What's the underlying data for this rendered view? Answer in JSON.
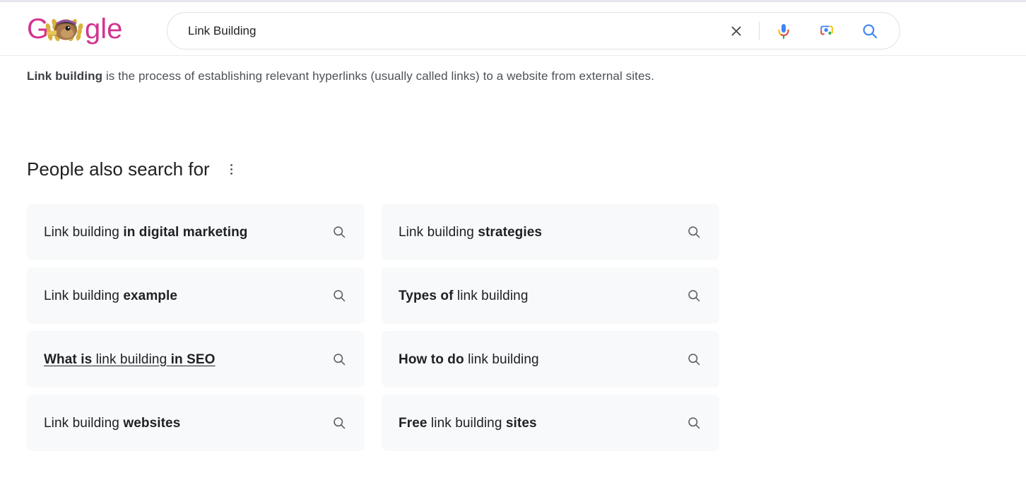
{
  "browser": {
    "top_bar_color": "#e8e7f0"
  },
  "header": {
    "logo": {
      "name": "google-doodle-logo",
      "alt": "Google Doodle",
      "letter_color": "#d2358f",
      "has_doodle": true,
      "doodle_subject": "duck-with-wheat-wreath"
    },
    "search": {
      "value": "Link Building",
      "placeholder": "Search Google or type a URL",
      "clear_icon": "close-icon",
      "mic_icon": "microphone-icon",
      "lens_icon": "google-lens-icon",
      "search_icon": "search-icon",
      "search_icon_color": "#4285f4"
    }
  },
  "main": {
    "featured_snippet": {
      "lead": "Link building",
      "rest": " is the process of establishing relevant hyperlinks (usually called links) to a website from external sites."
    },
    "people_also_search_for": {
      "title": "People also search for",
      "kebab_icon": "more-options-icon",
      "items": [
        {
          "prefix": "Link building ",
          "bold": "in digital marketing",
          "suffix": "",
          "full": "Link building in digital marketing",
          "icon": "search-icon",
          "hovered": false
        },
        {
          "prefix": "Link building ",
          "bold": "strategies",
          "suffix": "",
          "full": "Link building strategies",
          "icon": "search-icon",
          "hovered": false
        },
        {
          "prefix": "Link building ",
          "bold": "example",
          "suffix": "",
          "full": "Link building example",
          "icon": "search-icon",
          "hovered": false
        },
        {
          "prefix": "",
          "bold": "Types of",
          "suffix": " link building",
          "full": "Types of link building",
          "icon": "search-icon",
          "hovered": false
        },
        {
          "prefix": "",
          "bold": "What is",
          "suffix": " link building ",
          "bold2": "in SEO",
          "full": "What is link building in SEO",
          "icon": "search-icon",
          "hovered": true
        },
        {
          "prefix": "",
          "bold": "How to do",
          "suffix": " link building",
          "full": "How to do link building",
          "icon": "search-icon",
          "hovered": false
        },
        {
          "prefix": "Link building ",
          "bold": "websites",
          "suffix": "",
          "full": "Link building websites",
          "icon": "search-icon",
          "hovered": false
        },
        {
          "prefix": "",
          "bold": "Free",
          "suffix": " link building ",
          "bold2": "sites",
          "full": "Free link building sites",
          "icon": "search-icon",
          "hovered": false
        }
      ]
    }
  }
}
